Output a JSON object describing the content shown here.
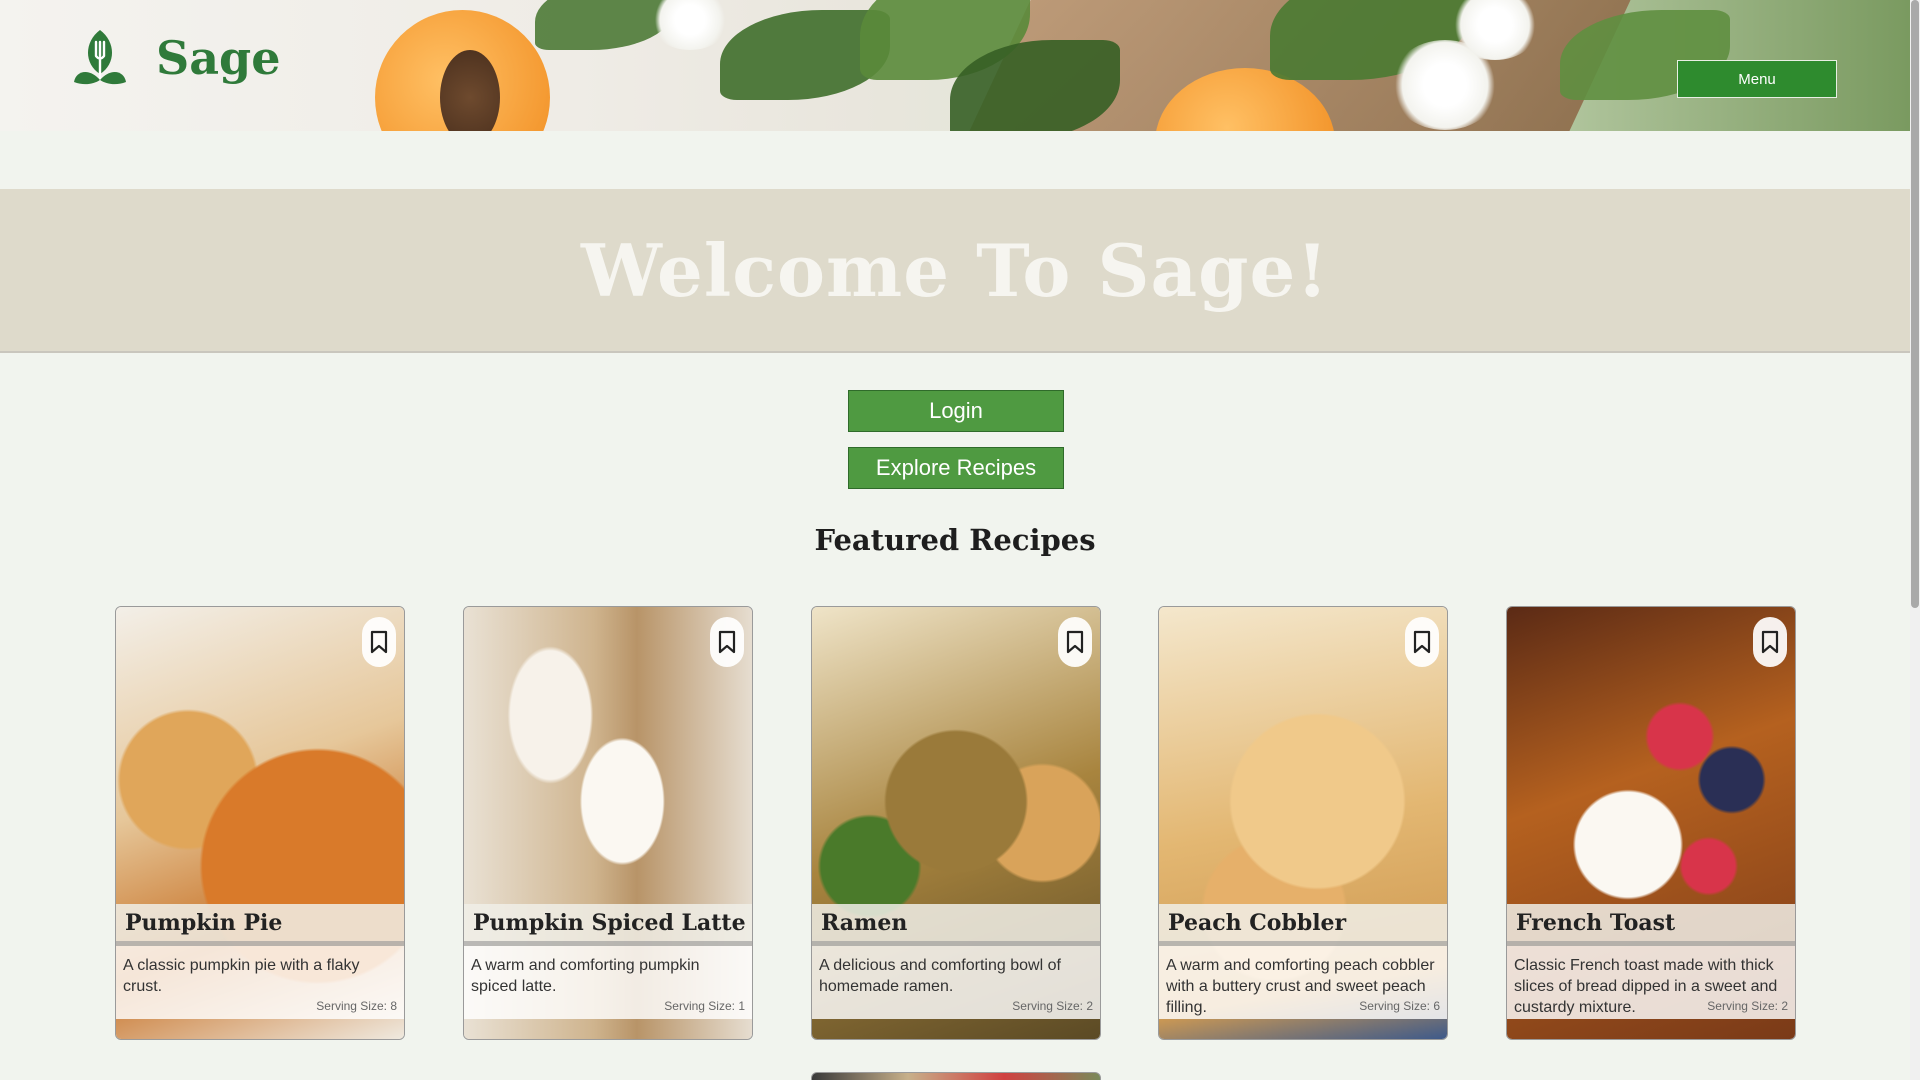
{
  "header": {
    "brand": "Sage",
    "menu_label": "Menu"
  },
  "hero": {
    "title": "Welcome To Sage!"
  },
  "actions": {
    "login_label": "Login",
    "explore_label": "Explore Recipes"
  },
  "featured": {
    "heading": "Featured Recipes",
    "recipes": [
      {
        "title": "Pumpkin Pie",
        "description": "A classic pumpkin pie with a flaky crust.",
        "serving": "Serving Size: 8"
      },
      {
        "title": "Pumpkin Spiced Latte",
        "description": "A warm and comforting pumpkin spiced latte.",
        "serving": "Serving Size: 1"
      },
      {
        "title": "Ramen",
        "description": "A delicious and comforting bowl of homemade ramen.",
        "serving": "Serving Size: 2"
      },
      {
        "title": "Peach Cobbler",
        "description": "A warm and comforting peach cobbler with a buttery crust and sweet peach filling.",
        "serving": "Serving Size: 6"
      },
      {
        "title": "French Toast",
        "description": "Classic French toast made with thick slices of bread dipped in a sweet and custardy mixture.",
        "serving": "Serving Size: 2"
      }
    ]
  },
  "colors": {
    "brand_green": "#2f7a3a",
    "button_green": "#4f9a41",
    "welcome_band": "#dedacb"
  }
}
